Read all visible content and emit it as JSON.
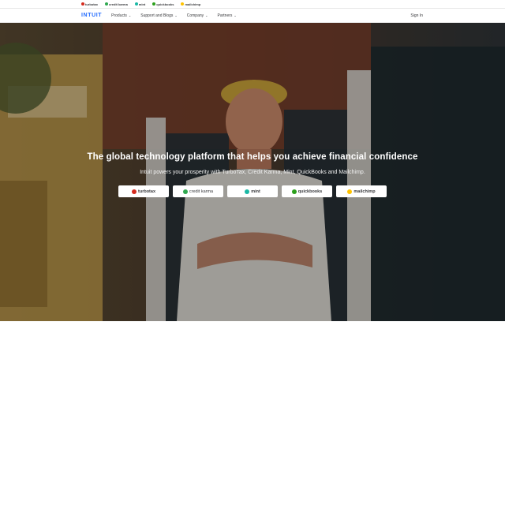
{
  "brand_strip": [
    {
      "label": "turbotax",
      "icon": "turbotax-logo-icon",
      "color": "#d52b1e"
    },
    {
      "label": "credit karma",
      "icon": "credit-karma-logo-icon",
      "color": "#2fa84f"
    },
    {
      "label": "mint",
      "icon": "mint-logo-icon",
      "color": "#1ab8a5"
    },
    {
      "label": "quickbooks",
      "icon": "quickbooks-logo-icon",
      "color": "#2ca01c"
    },
    {
      "label": "mailchimp",
      "icon": "mailchimp-logo-icon",
      "color": "#ffc300"
    }
  ],
  "nav": {
    "logo": "INTUIT",
    "items": [
      {
        "label": "Products"
      },
      {
        "label": "Support and Blogs"
      },
      {
        "label": "Company"
      },
      {
        "label": "Partners"
      }
    ],
    "sign_in": "Sign In"
  },
  "hero": {
    "title": "The global technology platform that helps you achieve financial confidence",
    "subtitle": "Intuit powers your prosperity with TurboTax, Credit Karma, Mint, QuickBooks and Mailchimp.",
    "buttons": [
      {
        "label": "turbotax",
        "color": "#d52b1e"
      },
      {
        "label": "credit karma",
        "color": "#2fa84f"
      },
      {
        "label": "mint",
        "color": "#1ab8a5"
      },
      {
        "label": "quickbooks",
        "color": "#2ca01c"
      },
      {
        "label": "mailchimp",
        "color": "#ffc300"
      }
    ]
  },
  "colors": {
    "accent": "#236cff",
    "text": "#393a3d"
  }
}
